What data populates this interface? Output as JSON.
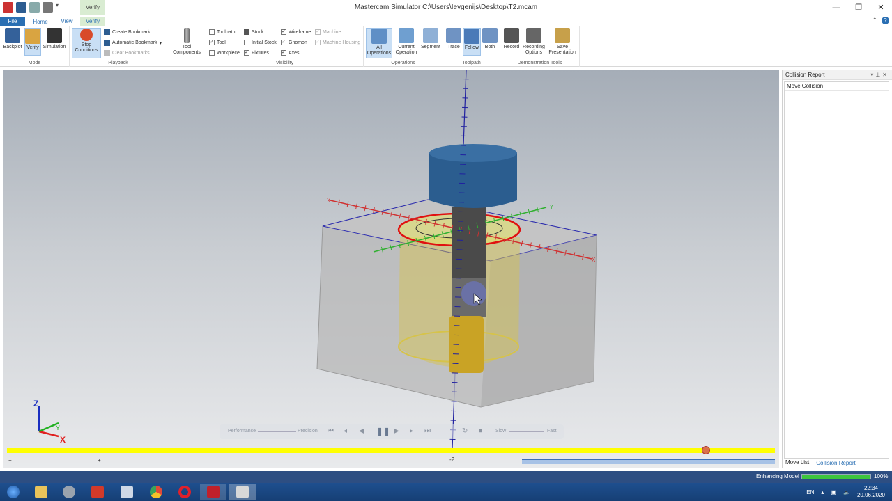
{
  "window": {
    "title": "Mastercam Simulator  C:\\Users\\Ievgenijs\\Desktop\\T2.mcam",
    "context_tab_header": "Verify",
    "controls": [
      "—",
      "❐",
      "✕"
    ]
  },
  "tabs": {
    "file": "File",
    "home": "Home",
    "view": "View",
    "verify": "Verify"
  },
  "ribbon": {
    "mode": {
      "label": "Mode",
      "backplot": "Backplot",
      "verify": "Verify",
      "simulation": "Simulation"
    },
    "playback": {
      "label": "Playback",
      "stop_conditions": "Stop Conditions",
      "create_bookmark": "Create Bookmark",
      "automatic_bookmark": "Automatic Bookmark",
      "clear_bookmarks": "Clear Bookmarks"
    },
    "tool_components": "Tool Components",
    "visibility": {
      "label": "Visibility",
      "toolpath": "Toolpath",
      "tool": "Tool",
      "workpiece": "Workpiece",
      "stock": "Stock",
      "initial_stock": "Initial Stock",
      "fixtures": "Fixtures",
      "wireframe": "Wireframe",
      "gnomon": "Gnomon",
      "axes": "Axes",
      "machine": "Machine",
      "machine_housing": "Machine Housing"
    },
    "operations": {
      "label": "Operations",
      "all": "All Operations",
      "current": "Current Operation",
      "segment": "Segment"
    },
    "toolpath": {
      "label": "Toolpath",
      "trace": "Trace",
      "follow": "Follow",
      "both": "Both"
    },
    "demo": {
      "label": "Demonstration Tools",
      "record": "Record",
      "recording_options": "Recording Options",
      "save_presentation": "Save Presentation"
    }
  },
  "viewport": {
    "axis_labels": {
      "x": "X",
      "y": "Y",
      "z": "Z",
      "plus_x": "+X",
      "plus_y": "+Y"
    },
    "playbar": {
      "performance": "Performance",
      "precision": "Precision",
      "slow": "Slow",
      "fast": "Fast"
    },
    "timeline_marker": "-2",
    "timeline_position": 0.91,
    "colors": {
      "timeline": "#ffff00",
      "collision": "#e01010",
      "holder": "#2b5d8f"
    }
  },
  "collision_panel": {
    "title": "Collision Report",
    "column": "Move Collision",
    "tabs": [
      "Move List",
      "Collision Report"
    ]
  },
  "status": {
    "text": "Enhancing Model",
    "percent_label": "100%",
    "progress": 1.0
  },
  "taskbar": {
    "apps": [
      "start-orb",
      "explorer",
      "settings-app",
      "acrobat",
      "word-doc",
      "chrome",
      "opera",
      "mastercam-2020",
      "simulator"
    ],
    "lang": "EN",
    "time": "22:34",
    "date": "20.06.2020"
  }
}
